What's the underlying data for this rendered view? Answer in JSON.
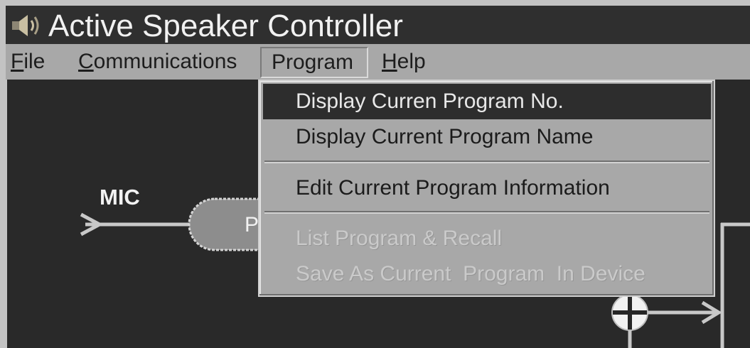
{
  "window": {
    "title": "Active Speaker Controller",
    "icon": "speaker-icon"
  },
  "menubar": {
    "items": [
      {
        "label": "File"
      },
      {
        "label": "Communications"
      },
      {
        "label": "Program",
        "open": true
      },
      {
        "label": "Help"
      }
    ]
  },
  "program_menu": {
    "groups": [
      [
        {
          "label": "Display Curren Program No.",
          "highlighted": true,
          "enabled": true
        },
        {
          "label": "Display Current Program Name",
          "highlighted": false,
          "enabled": true
        }
      ],
      [
        {
          "label": "Edit Current Program Information",
          "highlighted": false,
          "enabled": true
        }
      ],
      [
        {
          "label": "List Program & Recall",
          "highlighted": false,
          "enabled": false
        },
        {
          "label": "Save As Current  Program  In Device",
          "highlighted": false,
          "enabled": false
        }
      ]
    ]
  },
  "diagram": {
    "input_label": "MIC",
    "block_label": "P",
    "summing_node_icon": "plus-circle-icon"
  },
  "colors": {
    "title_bar": "#2f2f2f",
    "menu_bar": "#a8a8a8",
    "canvas": "#292929",
    "menu_highlight": "#2d2d2d",
    "signal_line": "#c8c8c8",
    "block_fill": "#8d8d8d"
  }
}
